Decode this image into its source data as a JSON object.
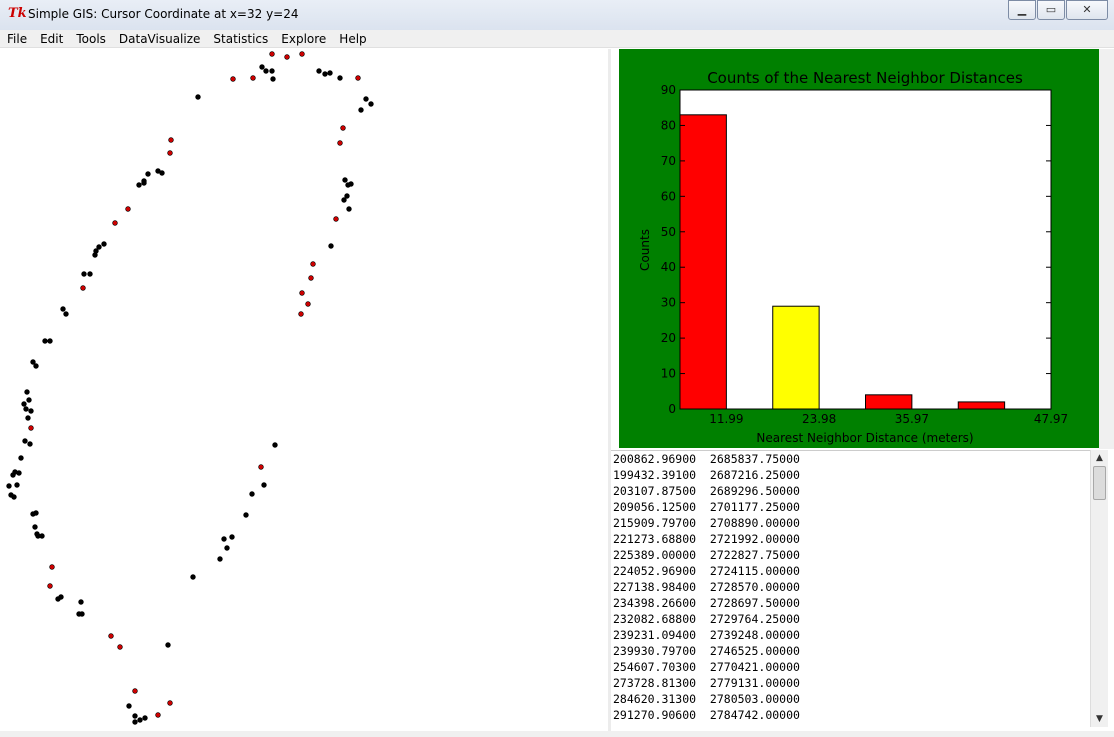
{
  "window": {
    "title": "Simple GIS: Cursor Coordinate at x=32  y=24",
    "icon": "tk-feather-icon",
    "controls": [
      "minimize",
      "maximize",
      "close"
    ]
  },
  "menubar": {
    "items": [
      "File",
      "Edit",
      "Tools",
      "DataVisualize",
      "Statistics",
      "Explore",
      "Help"
    ]
  },
  "colors": {
    "chart_background": "#008000",
    "bar_red": "#ff0000",
    "bar_yellow": "#ffff00",
    "point_black": "#000000",
    "point_red": "#cc0000"
  },
  "map": {
    "points_black": [
      [
        262,
        67
      ],
      [
        266,
        71
      ],
      [
        272,
        71
      ],
      [
        273,
        79
      ],
      [
        319,
        71
      ],
      [
        325,
        74
      ],
      [
        330,
        73
      ],
      [
        340,
        78
      ],
      [
        371,
        104
      ],
      [
        366,
        99
      ],
      [
        361,
        110
      ],
      [
        198,
        97
      ],
      [
        345,
        180
      ],
      [
        348,
        185
      ],
      [
        351,
        184
      ],
      [
        344,
        200
      ],
      [
        347,
        196
      ],
      [
        349,
        209
      ],
      [
        139,
        185
      ],
      [
        144,
        181
      ],
      [
        148,
        174
      ],
      [
        144,
        183
      ],
      [
        158,
        171
      ],
      [
        162,
        173
      ],
      [
        331,
        246
      ],
      [
        96,
        251
      ],
      [
        99,
        247
      ],
      [
        95,
        255
      ],
      [
        104,
        244
      ],
      [
        84,
        274
      ],
      [
        90,
        274
      ],
      [
        63,
        309
      ],
      [
        66,
        314
      ],
      [
        45,
        341
      ],
      [
        50,
        341
      ],
      [
        33,
        362
      ],
      [
        36,
        366
      ],
      [
        27,
        392
      ],
      [
        29,
        400
      ],
      [
        24,
        404
      ],
      [
        26,
        409
      ],
      [
        31,
        411
      ],
      [
        28,
        418
      ],
      [
        25,
        441
      ],
      [
        30,
        444
      ],
      [
        21,
        458
      ],
      [
        15,
        472
      ],
      [
        19,
        473
      ],
      [
        13,
        475
      ],
      [
        9,
        486
      ],
      [
        17,
        485
      ],
      [
        11,
        495
      ],
      [
        14,
        497
      ],
      [
        33,
        514
      ],
      [
        36,
        513
      ],
      [
        35,
        527
      ],
      [
        38,
        536
      ],
      [
        42,
        536
      ],
      [
        37,
        534
      ],
      [
        275,
        445
      ],
      [
        264,
        485
      ],
      [
        252,
        494
      ],
      [
        246,
        515
      ],
      [
        232,
        537
      ],
      [
        224,
        539
      ],
      [
        220,
        559
      ],
      [
        227,
        548
      ],
      [
        193,
        577
      ],
      [
        58,
        599
      ],
      [
        61,
        597
      ],
      [
        81,
        602
      ],
      [
        79,
        614
      ],
      [
        82,
        614
      ],
      [
        168,
        645
      ],
      [
        129,
        706
      ],
      [
        135,
        716
      ],
      [
        135,
        722
      ],
      [
        140,
        720
      ],
      [
        145,
        718
      ]
    ],
    "points_red": [
      [
        272,
        54
      ],
      [
        287,
        57
      ],
      [
        302,
        54
      ],
      [
        233,
        79
      ],
      [
        253,
        78
      ],
      [
        358,
        78
      ],
      [
        343,
        128
      ],
      [
        340,
        143
      ],
      [
        171,
        140
      ],
      [
        170,
        153
      ],
      [
        128,
        209
      ],
      [
        115,
        223
      ],
      [
        336,
        219
      ],
      [
        313,
        264
      ],
      [
        311,
        278
      ],
      [
        83,
        288
      ],
      [
        302,
        293
      ],
      [
        308,
        304
      ],
      [
        301,
        314
      ],
      [
        31,
        428
      ],
      [
        261,
        467
      ],
      [
        52,
        567
      ],
      [
        50,
        586
      ],
      [
        111,
        636
      ],
      [
        120,
        647
      ],
      [
        135,
        691
      ],
      [
        170,
        703
      ],
      [
        158,
        715
      ]
    ]
  },
  "chart_data": {
    "type": "bar",
    "title": "Counts of the Nearest Neighbor Distances",
    "xlabel": "Nearest Neighbor Distance (meters)",
    "ylabel": "Counts",
    "categories": [
      "11.99",
      "23.98",
      "35.97",
      "47.97"
    ],
    "values": [
      83,
      29,
      4,
      2
    ],
    "bar_colors": [
      "#ff0000",
      "#ffff00",
      "#ff0000",
      "#ff0000"
    ],
    "ylim": [
      0,
      90
    ],
    "yticks": [
      0,
      10,
      20,
      30,
      40,
      50,
      60,
      70,
      80,
      90
    ],
    "grid": false
  },
  "coordinates": [
    "200862.96900  2685837.75000",
    "199432.39100  2687216.25000",
    "203107.87500  2689296.50000",
    "209056.12500  2701177.25000",
    "215909.79700  2708890.00000",
    "221273.68800  2721992.00000",
    "225389.00000  2722827.75000",
    "224052.96900  2724115.00000",
    "227138.98400  2728570.00000",
    "234398.26600  2728697.50000",
    "232082.68800  2729764.25000",
    "239231.09400  2739248.00000",
    "239930.79700  2746525.00000",
    "254607.70300  2770421.00000",
    "273728.81300  2779131.00000",
    "284620.31300  2780503.00000",
    "291270.90600  2784742.00000"
  ]
}
